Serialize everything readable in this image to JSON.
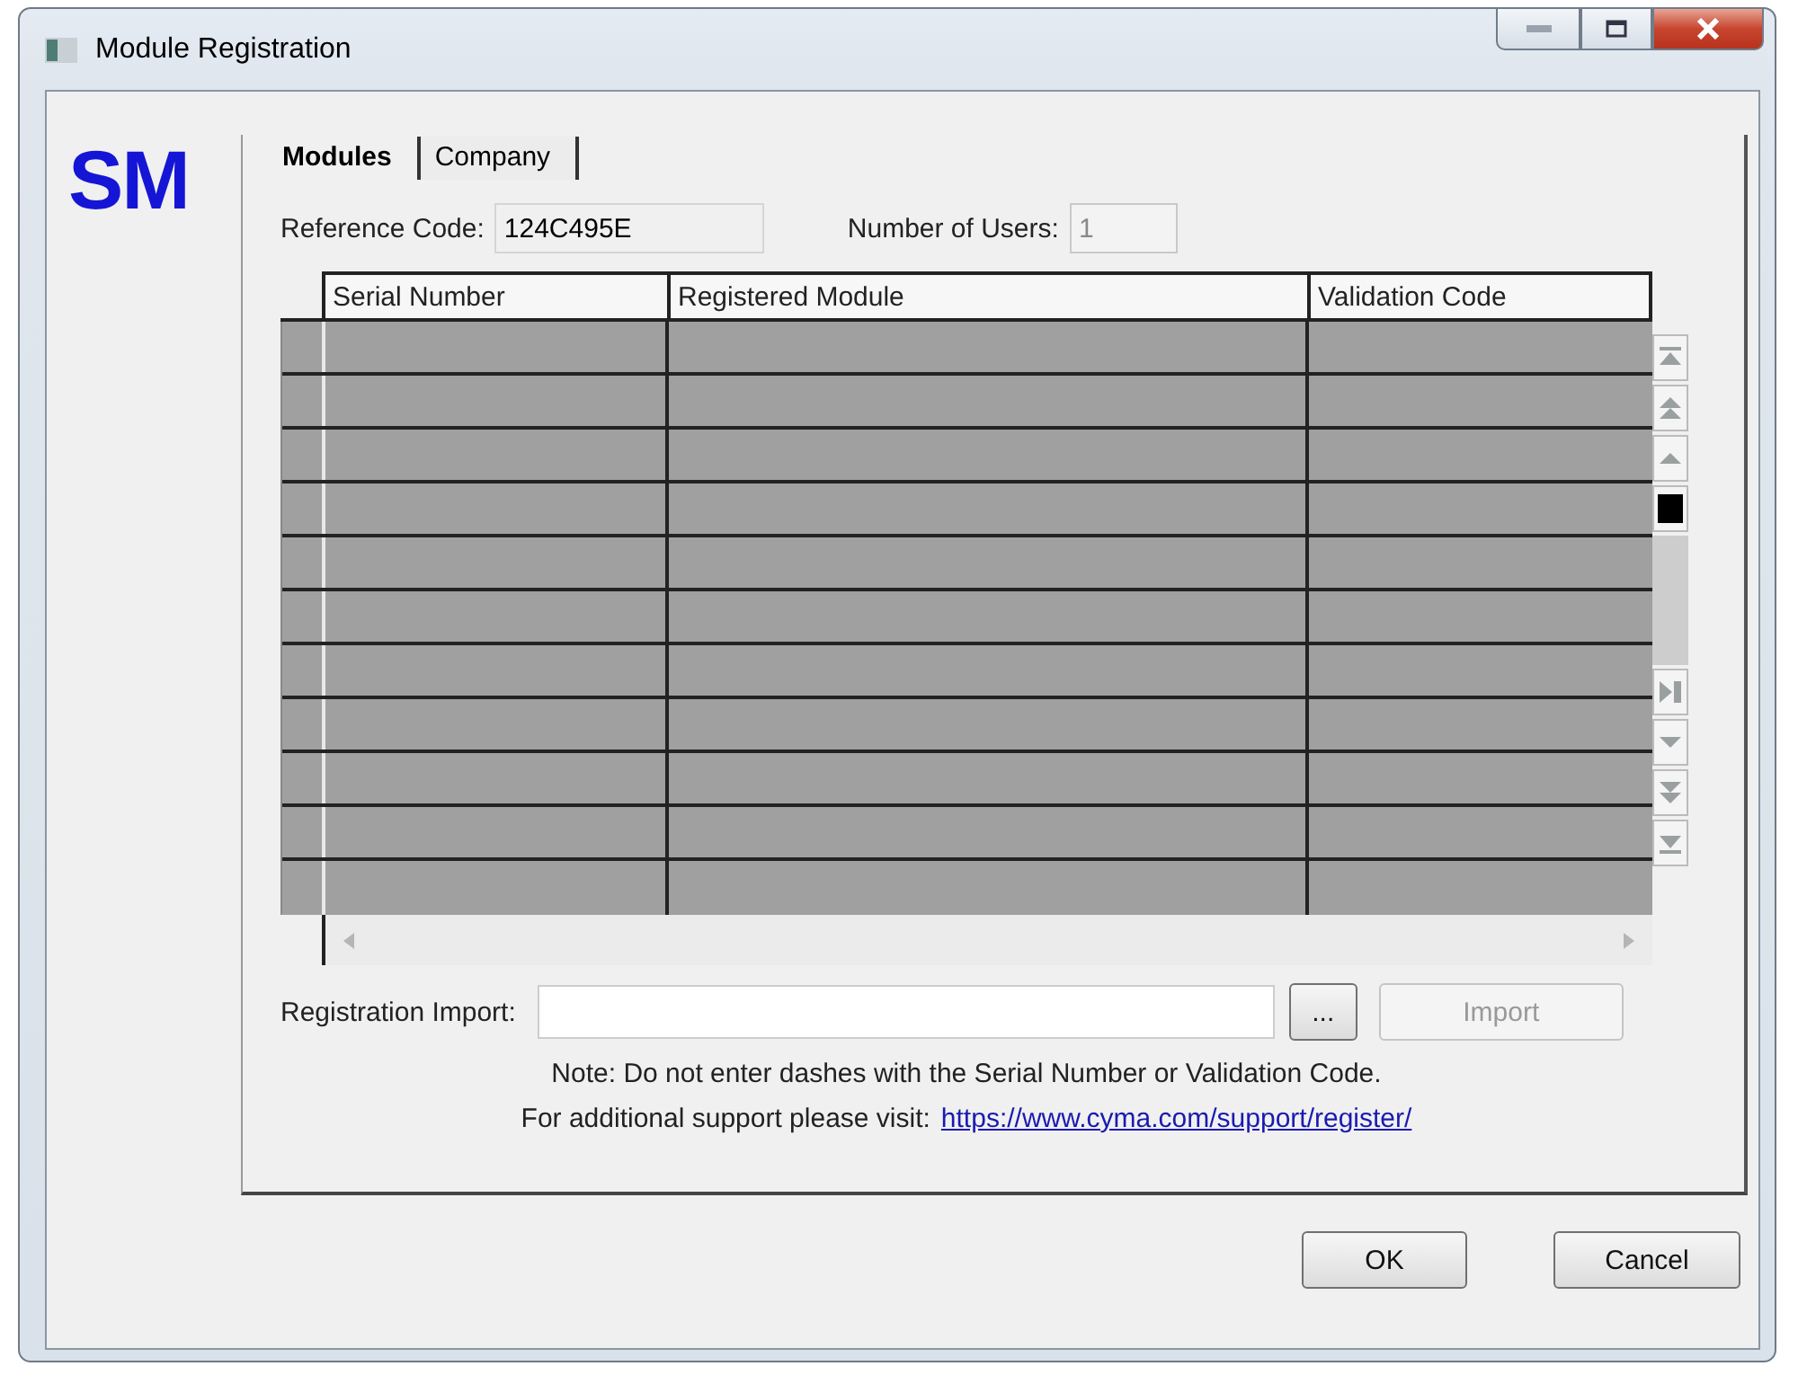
{
  "window": {
    "title": "Module Registration"
  },
  "logo": "SM",
  "tabs": [
    {
      "label": "Modules",
      "selected": true
    },
    {
      "label": "Company",
      "selected": false
    }
  ],
  "reference_code": {
    "label": "Reference Code:",
    "value": "124C495E"
  },
  "number_of_users": {
    "label": "Number of Users:",
    "value": "1",
    "disabled": true
  },
  "table": {
    "columns": [
      "Serial Number",
      "Registered Module",
      "Validation Code"
    ]
  },
  "registration_import": {
    "label": "Registration Import:",
    "browse_button": "...",
    "import_button": {
      "label": "Import",
      "disabled": true
    }
  },
  "note": "Note: Do not enter dashes with the Serial Number or Validation Code.",
  "support": {
    "text": "For additional support please visit:",
    "link": "https://www.cyma.com/support/register/"
  },
  "buttons": [
    "OK",
    "Cancel"
  ]
}
